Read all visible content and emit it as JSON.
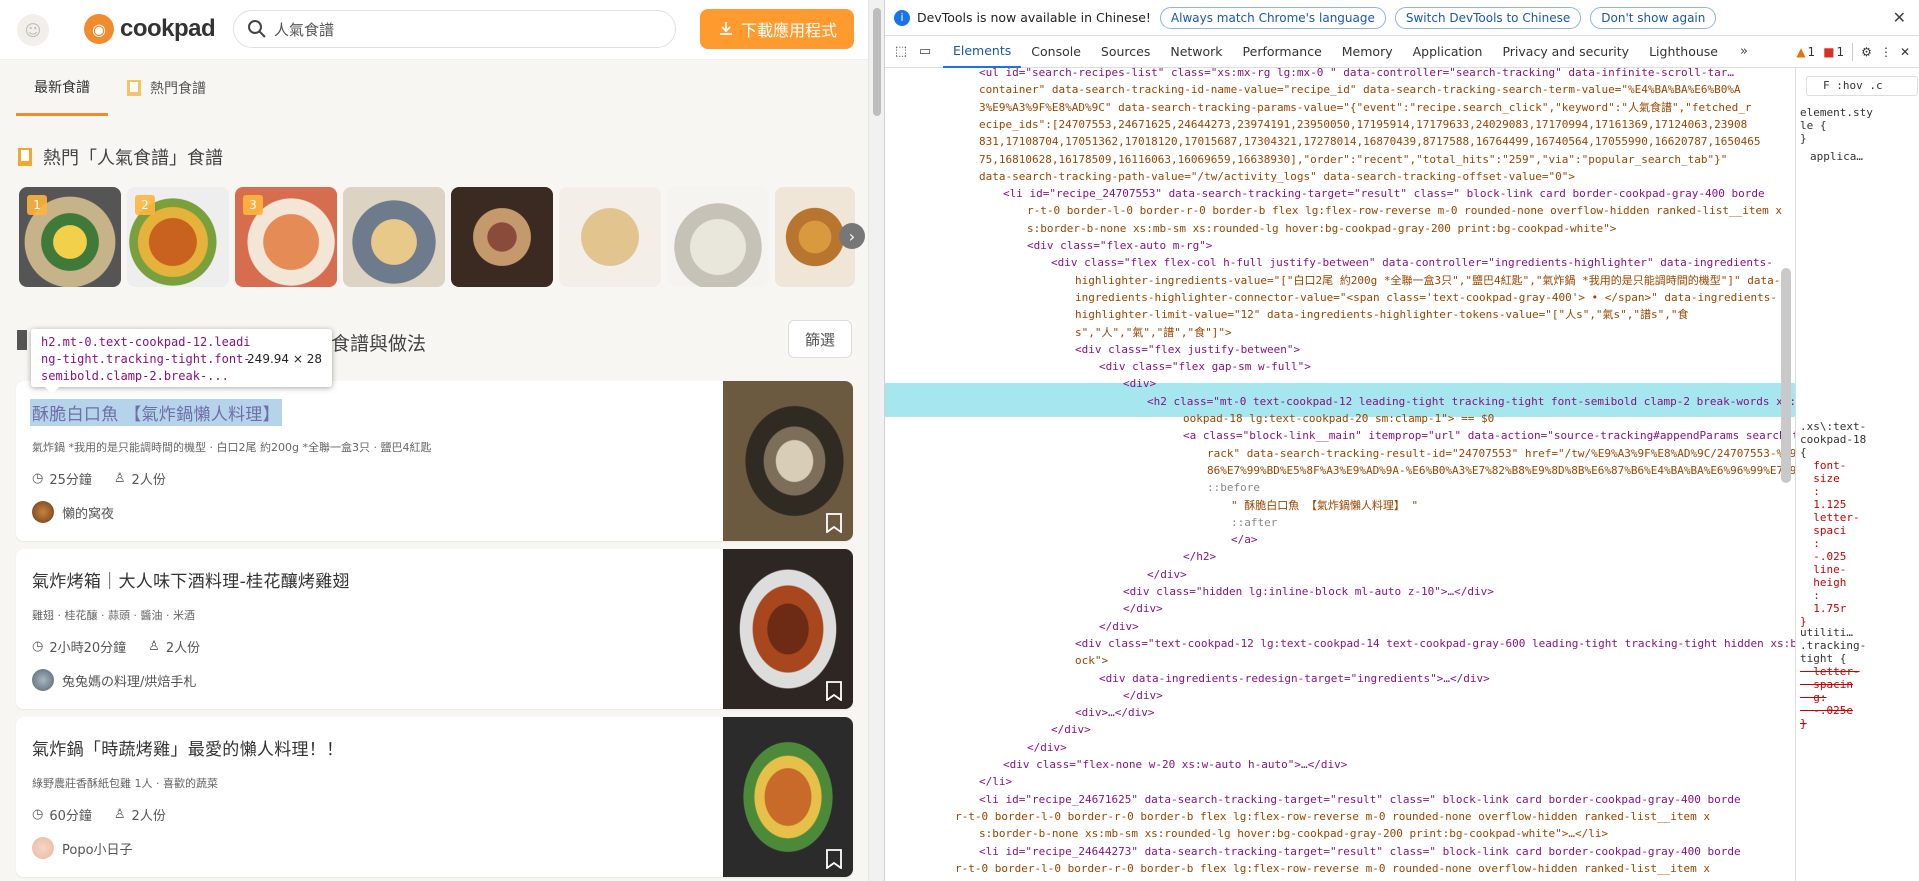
{
  "header": {
    "logo_text": "cookpad",
    "search_value": "人氣食譜",
    "download_label": "下載應用程式"
  },
  "tabs": [
    {
      "label": "最新食譜",
      "active": true
    },
    {
      "label": "熱門食譜",
      "active": false
    }
  ],
  "popular": {
    "title": "熱門「人氣食譜」食譜",
    "ranks": [
      "1",
      "2",
      "3"
    ]
  },
  "results": {
    "title_tail": "食譜與做法",
    "filter_label": "篩選"
  },
  "tooltip": {
    "selector": "h2.mt-0.text-cookpad-12.leading-tight.tracking-tight.font-semibold.clamp-2.break-...",
    "size": "249.94 × 28"
  },
  "cards": [
    {
      "title": "酥脆白口魚 【氣炸鍋懶人料理】",
      "ingredients": "氣炸鍋 *我用的是只能調時間的機型 · 白口2尾 約200g *全聯一盒3只 · 鹽巴4紅匙",
      "time": "25分鐘",
      "serving": "2人份",
      "author": "懶的窝夜"
    },
    {
      "title": "氣炸烤箱｜大人味下酒料理-桂花釀烤雞翅",
      "ingredients": "雞翅 · 桂花釀 · 蒜頭 · 醬油 · 米酒",
      "time": "2小時20分鐘",
      "serving": "2人份",
      "author": "兔兔媽の料理/烘焙手札"
    },
    {
      "title": "氣炸鍋「時蔬烤雞」最愛的懶人料理！！",
      "ingredients": "綠野農莊香酥紙包雞 1人 · 喜歡的蔬菜",
      "time": "60分鐘",
      "serving": "2人份",
      "author": "Popo小日子"
    }
  ],
  "devtools": {
    "banner_text": "DevTools is now available in Chinese!",
    "banner_buttons": [
      "Always match Chrome's language",
      "Switch DevTools to Chinese",
      "Don't show again"
    ],
    "tabs": [
      "Elements",
      "Console",
      "Sources",
      "Network",
      "Performance",
      "Memory",
      "Application",
      "Privacy and security",
      "Lighthouse"
    ],
    "warn_count": "1",
    "error_count": "1",
    "side_filter": "F :hov .c",
    "side_element_style": "element.sty\nle {\n}",
    "side_applica": "applica…",
    "side_rule": ".xs\\:text-\ncookpad-18\n{",
    "side_props": "  font-\n  size\n  :\n  1.125\n  letter-\n  spaci\n  :\n  -.025\n  line-\n  heigh\n  :\n  1.75r\n}",
    "side_util": "utiliti…\n.tracking-\ntight {",
    "side_util_props": "  letter-\n  spacin\n  g:\n  -.025e\n}"
  },
  "dom_lines": [
    "<ul id=\"search-recipes-list\" class=\"xs:mx-rg lg:mx-0 \" data-controller=\"search-tracking\" data-infinite-scroll-tar…",
    "container\" data-search-tracking-id-name-value=\"recipe_id\" data-search-tracking-search-term-value=\"%E4%BA%BA%E6%B0%A",
    "3%E9%A3%9F%E8%AD%9C\" data-search-tracking-params-value=\"{\"event\":\"recipe.search_click\",\"keyword\":\"人氣食譜\",\"fetched_r",
    "ecipe_ids\":[24707553,24671625,24644273,23974191,23950050,17195914,17179633,24029083,17170994,17161369,17124063,23908",
    "831,17108704,17051362,17018120,17015687,17304321,17278014,16870439,8717588,16764499,16740564,17055990,16620787,1650465",
    "75,16810628,16178509,16116063,16069659,16638930],\"order\":\"recent\",\"total_hits\":\"259\",\"via\":\"popular_search_tab\"}\"",
    "data-search-tracking-path-value=\"/tw/activity_logs\" data-search-tracking-offset-value=\"0\">",
    "<li id=\"recipe_24707553\" data-search-tracking-target=\"result\" class=\" block-link card border-cookpad-gray-400 borde",
    "r-t-0 border-l-0 border-r-0 border-b flex lg:flex-row-reverse m-0 rounded-none overflow-hidden ranked-list__item x",
    "s:border-b-none xs:mb-sm xs:rounded-lg hover:bg-cookpad-gray-200 print:bg-cookpad-white\">",
    "<div class=\"flex-auto m-rg\">",
    "<div class=\"flex flex-col h-full justify-between\" data-controller=\"ingredients-highlighter\" data-ingredients-",
    "highlighter-ingredients-value=\"[\"白口2尾 約200g *全聯一盒3只\",\"鹽巴4紅匙\",\"氣炸鍋 *我用的是只能調時間的機型\"]\" data-",
    "ingredients-highlighter-connector-value=\"<span class='text-cookpad-gray-400'> • </span>\" data-ingredients-",
    "highlighter-limit-value=\"12\" data-ingredients-highlighter-tokens-value=\"[\"人s\",\"氣s\",\"譜s\",\"食",
    "s\",\"人\",\"氣\",\"譜\",\"食\"]\">",
    "<div class=\"flex justify-between\">",
    "<div class=\"flex gap-sm w-full\">",
    "<div>",
    "<h2 class=\"mt-0 text-cookpad-12 leading-tight tracking-tight font-semibold clamp-2 break-words xs:text-c",
    "ookpad-18 lg:text-cookpad-20 sm:clamp-1\"> == $0",
    "<a class=\"block-link__main\" itemprop=\"url\" data-action=\"source-tracking#appendParams search-tracking#t",
    "rack\" data-search-tracking-result-id=\"24707553\" href=\"/tw/%E9%A3%9F%E8%AD%9C/24707553-%E9%85%A5%E8%84%",
    "86%E7%99%BD%E5%8F%A3%E9%AD%9A-%E6%B0%A3%E7%82%B8%E9%8D%8B%E6%87%B6%E4%BA%BA%E6%96%99%E7%90%86\">",
    "::before",
    "\" 酥脆白口魚 【氣炸鍋懶人料理】 \"",
    "::after",
    "</a>",
    "</h2>",
    "</div>",
    "<div class=\"hidden lg:inline-block ml-auto z-10\">…</div>",
    "</div>",
    "</div>",
    "<div class=\"text-cookpad-12 lg:text-cookpad-14 text-cookpad-gray-600 leading-tight tracking-tight hidden xs:bl",
    "ock\">",
    "<div data-ingredients-redesign-target=\"ingredients\">…</div>",
    "</div>",
    "<div>…</div>",
    "</div>",
    "</div>",
    "<div class=\"flex-none w-20 xs:w-auto h-auto\">…</div>",
    "</li>",
    "<li id=\"recipe_24671625\" data-search-tracking-target=\"result\" class=\" block-link card border-cookpad-gray-400 borde",
    "r-t-0 border-l-0 border-r-0 border-b flex lg:flex-row-reverse m-0 rounded-none overflow-hidden ranked-list__item x",
    "s:border-b-none xs:mb-sm xs:rounded-lg hover:bg-cookpad-gray-200 print:bg-cookpad-white\">…</li>",
    "<li id=\"recipe_24644273\" data-search-tracking-target=\"result\" class=\" block-link card border-cookpad-gray-400 borde",
    "r-t-0 border-l-0 border-r-0 border-b flex lg:flex-row-reverse m-0 rounded-none overflow-hidden ranked-list__item x",
    "s:border-b-none xs:mb-sm xs:rounded-lg hover:bg-cookpad-gray-200 print:bg-cookpad-white\">…</li>"
  ],
  "colors": {
    "brand": "#f08c2d",
    "download_bg": "#ff9a2e",
    "highlight_row": "#a6e6ef",
    "title_highlight": "#b6d3ec"
  }
}
